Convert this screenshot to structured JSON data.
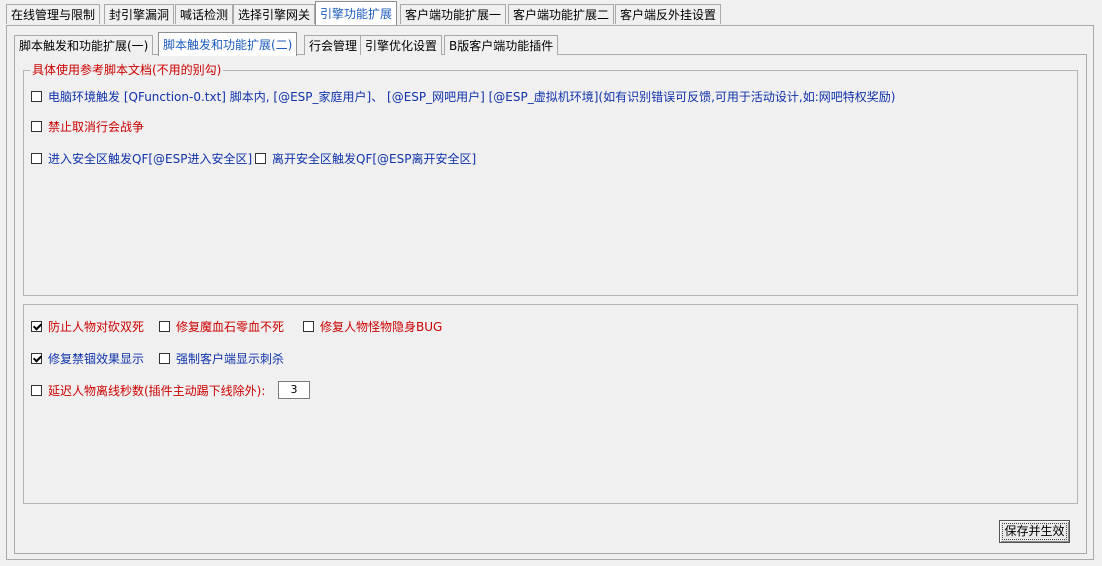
{
  "top_tabs": [
    {
      "label": "在线管理与限制",
      "active": false
    },
    {
      "label": "封引擎漏洞",
      "active": false
    },
    {
      "label": "喊话检测",
      "active": false
    },
    {
      "label": "选择引擎网关",
      "active": false
    },
    {
      "label": "引擎功能扩展",
      "active": true
    },
    {
      "label": "客户端功能扩展一",
      "active": false
    },
    {
      "label": "客户端功能扩展二",
      "active": false
    },
    {
      "label": "客户端反外挂设置",
      "active": false
    }
  ],
  "sub_tabs": [
    {
      "label": "脚本触发和功能扩展(一)",
      "active": false
    },
    {
      "label": "脚本触发和功能扩展(二)",
      "active": true
    },
    {
      "label": "行会管理",
      "active": false
    },
    {
      "label": "引擎优化设置",
      "active": false
    },
    {
      "label": "B版客户端功能插件",
      "active": false
    }
  ],
  "group1": {
    "title": "具体使用参考脚本文档(不用的别勾)",
    "options": [
      {
        "label": "电脑环境触发 [QFunction-0.txt] 脚本内, [@ESP_家庭用户]、 [@ESP_网吧用户] [@ESP_虚拟机环境](如有识别错误可反馈,可用于活动设计,如:网吧特权奖励)",
        "checked": false,
        "color": "blue"
      },
      {
        "label": "禁止取消行会战争",
        "checked": false,
        "color": "red"
      },
      {
        "label": "进入安全区触发QF[@ESP进入安全区]",
        "checked": false,
        "color": "blue"
      },
      {
        "label": "离开安全区触发QF[@ESP离开安全区]",
        "checked": false,
        "color": "blue"
      }
    ]
  },
  "group2": {
    "options": [
      {
        "label": "防止人物对砍双死",
        "checked": true,
        "color": "red"
      },
      {
        "label": "修复魔血石零血不死",
        "checked": false,
        "color": "red"
      },
      {
        "label": "修复人物怪物隐身BUG",
        "checked": false,
        "color": "red"
      },
      {
        "label": "修复禁锢效果显示",
        "checked": true,
        "color": "blue"
      },
      {
        "label": "强制客户端显示刺杀",
        "checked": false,
        "color": "blue"
      },
      {
        "label": "延迟人物离线秒数(插件主动踢下线除外):",
        "checked": false,
        "color": "red"
      }
    ],
    "delay_seconds": "3"
  },
  "save_button": "保存并生效"
}
